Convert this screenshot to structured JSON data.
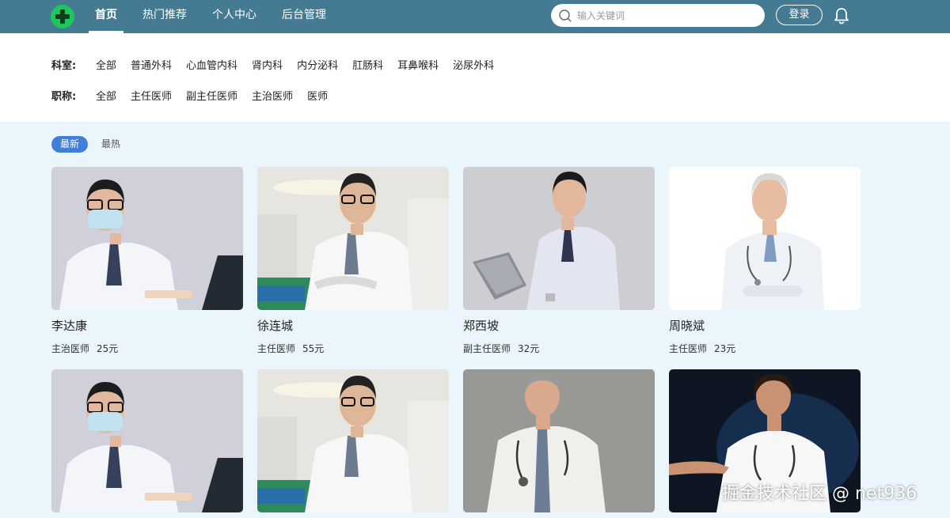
{
  "header": {
    "nav": [
      "首页",
      "热门推荐",
      "个人中心",
      "后台管理"
    ],
    "search_placeholder": "输入关键词",
    "login_label": "登录"
  },
  "filters": {
    "department_label": "科室:",
    "departments": [
      "全部",
      "普通外科",
      "心血管内科",
      "肾内科",
      "内分泌科",
      "肛肠科",
      "耳鼻喉科",
      "泌尿外科"
    ],
    "title_label": "职称:",
    "titles": [
      "全部",
      "主任医师",
      "副主任医师",
      "主治医师",
      "医师"
    ]
  },
  "sort": {
    "newest": "最新",
    "hottest": "最热"
  },
  "doctors": [
    {
      "name": "李达康",
      "title": "主治医师",
      "price": "25元"
    },
    {
      "name": "徐连城",
      "title": "主任医师",
      "price": "55元"
    },
    {
      "name": "郑西坡",
      "title": "副主任医师",
      "price": "32元"
    },
    {
      "name": "周晓斌",
      "title": "主任医师",
      "price": "23元"
    }
  ],
  "watermark": "掘金技术社区 @ net936",
  "colors": {
    "header": "#447a92",
    "accent": "#3f7fd8",
    "logo": "#1ec75a",
    "page_bg": "#eaf6fb"
  }
}
